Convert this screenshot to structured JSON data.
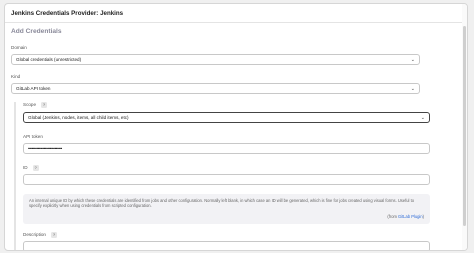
{
  "dialog": {
    "title": "Jenkins Credentials Provider: Jenkins",
    "section_title": "Add Credentials"
  },
  "domain": {
    "label": "Domain",
    "value": "Global credentials (unrestricted)"
  },
  "kind": {
    "label": "Kind",
    "value": "GitLab API token"
  },
  "scope": {
    "label": "Scope",
    "help": "?",
    "value": "Global (Jenkins, nodes, items, all child items, etc)"
  },
  "api_token": {
    "label": "API token",
    "value": "••••••••••••••••••••••••••••"
  },
  "id_field": {
    "label": "ID",
    "help": "?",
    "value": ""
  },
  "id_help": {
    "text": "An internal unique ID by which these credentials are identified from jobs and other configuration. Normally left blank, in which case an ID will be generated, which is fine for jobs created using visual forms. Useful to specify explicitly when using credentials from scripted configuration.",
    "from_prefix": "(from ",
    "from_link": "GitLab Plugin",
    "from_suffix": ")"
  },
  "description": {
    "label": "Description",
    "help": "?",
    "value": ""
  },
  "icons": {
    "chevron": "chevron-down-icon",
    "help": "help-icon"
  }
}
